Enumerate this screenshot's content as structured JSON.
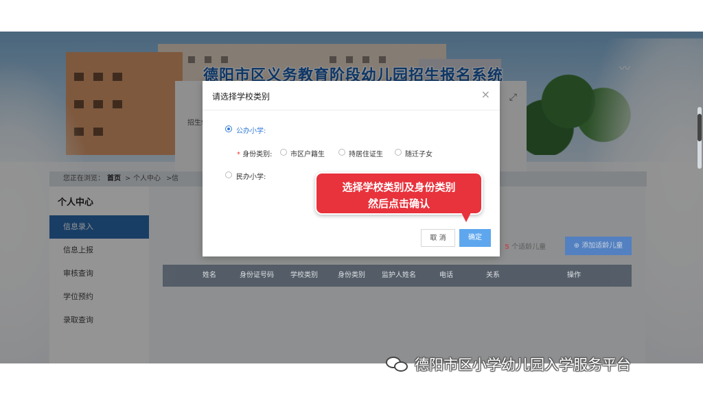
{
  "banner": {
    "title": "德阳市区义务教育阶段幼儿园招生报名系统"
  },
  "background_panel": {
    "label": "招生信",
    "expand_icon": "expand-icon"
  },
  "breadcrumb": {
    "prefix": "您正在浏览：",
    "home": "首页",
    "sep": ">",
    "current": "个人中心",
    "tail": "信"
  },
  "sidebar": {
    "title": "个人中心",
    "items": [
      {
        "label": "信息录入",
        "active": true
      },
      {
        "label": "信息上报",
        "active": false
      },
      {
        "label": "审核查询",
        "active": false
      },
      {
        "label": "学位预约",
        "active": false
      },
      {
        "label": "录取查询",
        "active": false
      }
    ]
  },
  "content": {
    "kid_count_number": "5",
    "kid_count_suffix": "个适龄儿童",
    "add_button": "⊕ 添加适龄儿童",
    "table_headers": [
      "姓名",
      "身份证号码",
      "学校类别",
      "身份类别",
      "监护人姓名",
      "电话",
      "关系",
      "操作"
    ]
  },
  "modal": {
    "title": "请选择学校类别",
    "close": "×",
    "option_public": "公办小学:",
    "identity_label": "身份类别:",
    "identity_required": "*",
    "identity_options": [
      "市区户籍生",
      "持居住证生",
      "随迁子女"
    ],
    "option_private": "民办小学:",
    "cancel": "取 消",
    "confirm": "确定"
  },
  "callout": {
    "line1": "选择学校类别及身份类别",
    "line2": "然后点击确认"
  },
  "watermark": {
    "text": "德阳市区小学幼儿园入学服务平台",
    "icon": "wechat-icon"
  },
  "colors": {
    "primary": "#2f79d6",
    "callout": "#e8323c",
    "sidebar_active": "#2b6cae",
    "table_header": "#4a5561"
  }
}
